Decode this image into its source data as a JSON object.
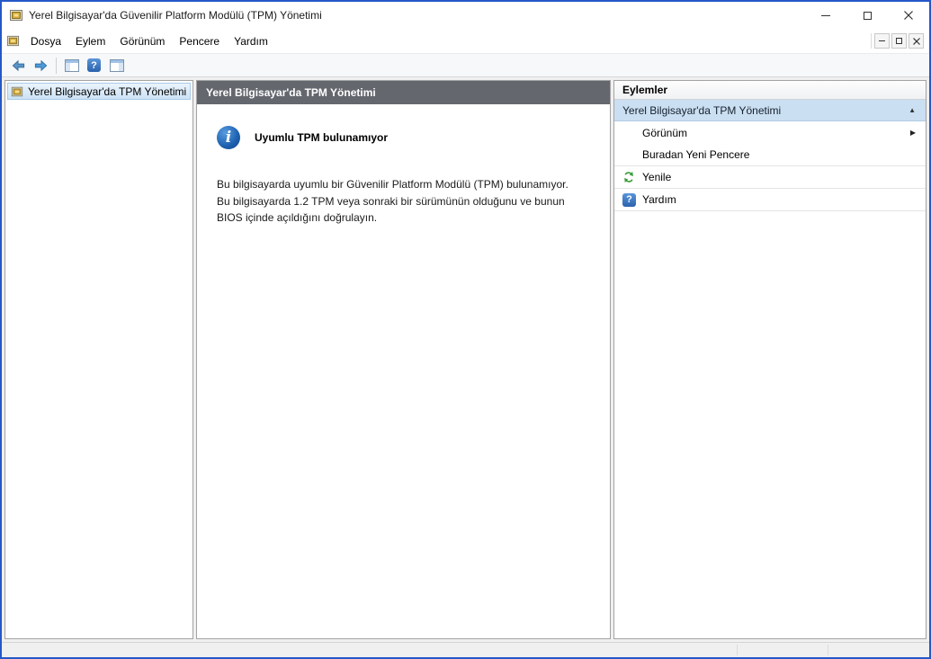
{
  "titlebar": {
    "title": "Yerel Bilgisayar'da Güvenilir Platform Modülü (TPM) Yönetimi"
  },
  "menubar": {
    "items": [
      "Dosya",
      "Eylem",
      "Görünüm",
      "Pencere",
      "Yardım"
    ]
  },
  "toolbar": {
    "help_glyph": "?"
  },
  "tree": {
    "root_label": "Yerel Bilgisayar'da TPM Yönetimi"
  },
  "main": {
    "header": "Yerel Bilgisayar'da TPM Yönetimi",
    "info_glyph": "i",
    "info_title": "Uyumlu TPM bulunamıyor",
    "body_lines": [
      "Bu bilgisayarda uyumlu bir Güvenilir Platform Modülü (TPM) bulunamıyor.",
      "Bu bilgisayarda 1.2 TPM veya sonraki bir sürümünün olduğunu ve bunun",
      "BIOS içinde açıldığını doğrulayın."
    ]
  },
  "actions": {
    "header": "Eylemler",
    "group_title": "Yerel Bilgisayar'da TPM Yönetimi",
    "collapse_arrow": "▲",
    "help_glyph": "?",
    "items": [
      {
        "label": "Görünüm",
        "arrow": "▶"
      },
      {
        "label": "Buradan Yeni Pencere"
      },
      {
        "label": "Yenile"
      },
      {
        "label": "Yardım"
      }
    ]
  },
  "icons": {
    "titlebar": [
      "app-icon",
      "minimize-icon",
      "maximize-icon",
      "close-icon"
    ],
    "menubar": [
      "app-icon",
      "mdi-minimize-icon",
      "mdi-restore-icon",
      "mdi-close-icon"
    ],
    "toolbar": [
      "back-arrow-icon",
      "forward-arrow-icon",
      "console-pane-icon",
      "help-icon",
      "console-pane-icon"
    ],
    "content": [
      "tpm-node-icon",
      "info-icon",
      "refresh-icon",
      "help-icon"
    ]
  },
  "colors": {
    "frame_blue": "#2458c7",
    "center_header_gray": "#64676e",
    "selection_blue": "#cbdff2",
    "refresh_green": "#3b9c3b"
  }
}
